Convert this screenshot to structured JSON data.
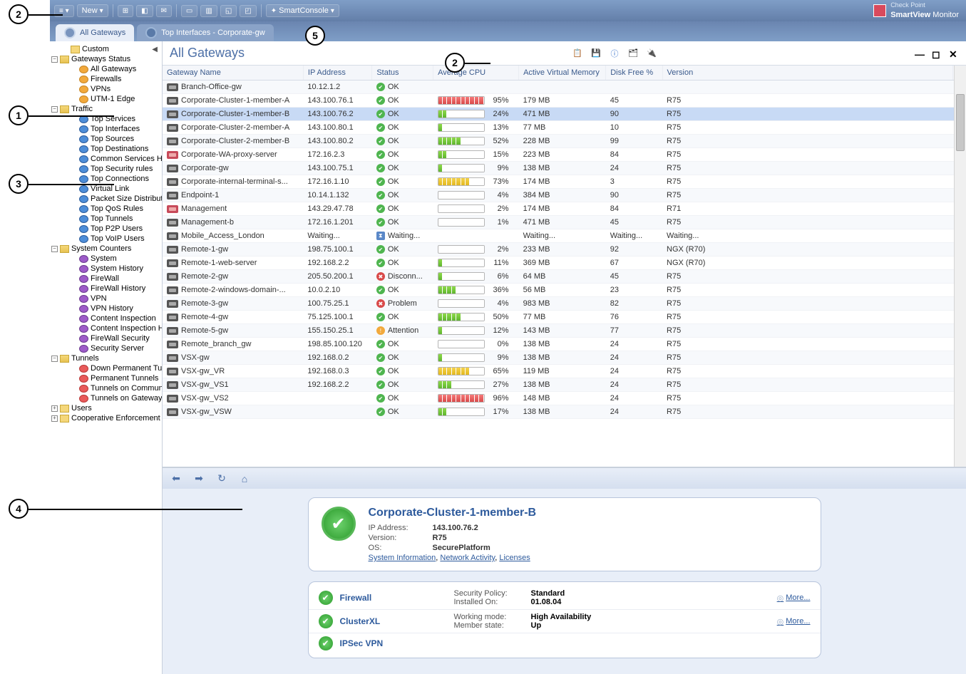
{
  "brand": {
    "line1": "Check Point",
    "line2a": "SmartView",
    "line2b": " Monitor"
  },
  "toolbar": {
    "smartconsole": "SmartConsole",
    "new": "New"
  },
  "tabs": [
    {
      "label": "All Gateways",
      "active": true
    },
    {
      "label": "Top Interfaces - Corporate-gw",
      "active": false
    }
  ],
  "sidebar": {
    "custom": "Custom",
    "gateways_status": "Gateways Status",
    "gw_items": [
      "All Gateways",
      "Firewalls",
      "VPNs",
      "UTM-1 Edge"
    ],
    "traffic": "Traffic",
    "traffic_items": [
      "Top Services",
      "Top Interfaces",
      "Top Sources",
      "Top Destinations",
      "Common Services History",
      "Top Security rules",
      "Top Connections",
      "Virtual Link",
      "Packet Size Distribution",
      "Top QoS Rules",
      "Top Tunnels",
      "Top P2P Users",
      "Top VoIP Users"
    ],
    "system_counters": "System Counters",
    "sys_items": [
      "System",
      "System History",
      "FireWall",
      "FireWall History",
      "VPN",
      "VPN History",
      "Content Inspection",
      "Content Inspection Histo",
      "FireWall Security",
      "Security Server"
    ],
    "tunnels": "Tunnels",
    "tun_items": [
      "Down Permanent Tunnels",
      "Permanent Tunnels",
      "Tunnels on Community",
      "Tunnels on Gateway"
    ],
    "users": "Users",
    "coop": "Cooperative Enforcement"
  },
  "content": {
    "title": "All Gateways",
    "columns": [
      "Gateway Name",
      "IP Address",
      "Status",
      "Average CPU",
      "Active Virtual Memory",
      "Disk Free %",
      "Version"
    ]
  },
  "rows": [
    {
      "name": "Branch-Office-gw",
      "ip": "10.12.1.2",
      "status": "OK",
      "st": "ok",
      "cpu": null,
      "mem": "",
      "disk": "",
      "ver": ""
    },
    {
      "name": "Corporate-Cluster-1-member-A",
      "ip": "143.100.76.1",
      "status": "OK",
      "st": "ok",
      "cpu": 95,
      "mem": "179 MB",
      "disk": "45",
      "ver": "R75"
    },
    {
      "name": "Corporate-Cluster-1-member-B",
      "ip": "143.100.76.2",
      "status": "OK",
      "st": "ok",
      "cpu": 24,
      "mem": "471 MB",
      "disk": "90",
      "ver": "R75",
      "selected": true
    },
    {
      "name": "Corporate-Cluster-2-member-A",
      "ip": "143.100.80.1",
      "status": "OK",
      "st": "ok",
      "cpu": 13,
      "mem": "77 MB",
      "disk": "10",
      "ver": "R75"
    },
    {
      "name": "Corporate-Cluster-2-member-B",
      "ip": "143.100.80.2",
      "status": "OK",
      "st": "ok",
      "cpu": 52,
      "mem": "228 MB",
      "disk": "99",
      "ver": "R75"
    },
    {
      "name": "Corporate-WA-proxy-server",
      "ip": "172.16.2.3",
      "status": "OK",
      "st": "ok",
      "cpu": 15,
      "mem": "223 MB",
      "disk": "84",
      "ver": "R75",
      "mgmt": true
    },
    {
      "name": "Corporate-gw",
      "ip": "143.100.75.1",
      "status": "OK",
      "st": "ok",
      "cpu": 9,
      "mem": "138 MB",
      "disk": "24",
      "ver": "R75"
    },
    {
      "name": "Corporate-internal-terminal-s...",
      "ip": "172.16.1.10",
      "status": "OK",
      "st": "ok",
      "cpu": 73,
      "mem": "174 MB",
      "disk": "3",
      "ver": "R75"
    },
    {
      "name": "Endpoint-1",
      "ip": "10.14.1.132",
      "status": "OK",
      "st": "ok",
      "cpu": 4,
      "mem": "384 MB",
      "disk": "90",
      "ver": "R75"
    },
    {
      "name": "Management",
      "ip": "143.29.47.78",
      "status": "OK",
      "st": "ok",
      "cpu": 2,
      "mem": "174 MB",
      "disk": "84",
      "ver": "R71",
      "mgmt": true
    },
    {
      "name": "Management-b",
      "ip": "172.16.1.201",
      "status": "OK",
      "st": "ok",
      "cpu": 1,
      "mem": "471 MB",
      "disk": "45",
      "ver": "R75"
    },
    {
      "name": "Mobile_Access_London",
      "ip": "Waiting...",
      "status": "Waiting...",
      "st": "wait",
      "cpu": null,
      "mem": "Waiting...",
      "disk": "Waiting...",
      "ver": "Waiting..."
    },
    {
      "name": "Remote-1-gw",
      "ip": "198.75.100.1",
      "status": "OK",
      "st": "ok",
      "cpu": 2,
      "mem": "233 MB",
      "disk": "92",
      "ver": "NGX (R70)"
    },
    {
      "name": "Remote-1-web-server",
      "ip": "192.168.2.2",
      "status": "OK",
      "st": "ok",
      "cpu": 11,
      "mem": "369 MB",
      "disk": "67",
      "ver": "NGX (R70)"
    },
    {
      "name": "Remote-2-gw",
      "ip": "205.50.200.1",
      "status": "Disconn...",
      "st": "disc",
      "cpu": 6,
      "mem": "64 MB",
      "disk": "45",
      "ver": "R75"
    },
    {
      "name": "Remote-2-windows-domain-...",
      "ip": "10.0.2.10",
      "status": "OK",
      "st": "ok",
      "cpu": 36,
      "mem": "56 MB",
      "disk": "23",
      "ver": "R75"
    },
    {
      "name": "Remote-3-gw",
      "ip": "100.75.25.1",
      "status": "Problem",
      "st": "prob",
      "cpu": 4,
      "mem": "983 MB",
      "disk": "82",
      "ver": "R75"
    },
    {
      "name": "Remote-4-gw",
      "ip": "75.125.100.1",
      "status": "OK",
      "st": "ok",
      "cpu": 50,
      "mem": "77 MB",
      "disk": "76",
      "ver": "R75"
    },
    {
      "name": "Remote-5-gw",
      "ip": "155.150.25.1",
      "status": "Attention",
      "st": "att",
      "cpu": 12,
      "mem": "143 MB",
      "disk": "77",
      "ver": "R75"
    },
    {
      "name": "Remote_branch_gw",
      "ip": "198.85.100.120",
      "status": "OK",
      "st": "ok",
      "cpu": 0,
      "mem": "138 MB",
      "disk": "24",
      "ver": "R75"
    },
    {
      "name": "VSX-gw",
      "ip": "192.168.0.2",
      "status": "OK",
      "st": "ok",
      "cpu": 9,
      "mem": "138 MB",
      "disk": "24",
      "ver": "R75"
    },
    {
      "name": "VSX-gw_VR",
      "ip": "192.168.0.3",
      "status": "OK",
      "st": "ok",
      "cpu": 65,
      "mem": "119 MB",
      "disk": "24",
      "ver": "R75"
    },
    {
      "name": "VSX-gw_VS1",
      "ip": "192.168.2.2",
      "status": "OK",
      "st": "ok",
      "cpu": 27,
      "mem": "138 MB",
      "disk": "24",
      "ver": "R75"
    },
    {
      "name": "VSX-gw_VS2",
      "ip": "",
      "status": "OK",
      "st": "ok",
      "cpu": 96,
      "mem": "148 MB",
      "disk": "24",
      "ver": "R75"
    },
    {
      "name": "VSX-gw_VSW",
      "ip": "",
      "status": "OK",
      "st": "ok",
      "cpu": 17,
      "mem": "138 MB",
      "disk": "24",
      "ver": "R75"
    }
  ],
  "detail": {
    "title": "Corporate-Cluster-1-member-B",
    "ip_label": "IP Address:",
    "ip": "143.100.76.2",
    "ver_label": "Version:",
    "ver": "R75",
    "os_label": "OS:",
    "os": "SecurePlatform",
    "links": [
      "System Information",
      "Network Activity",
      "Licenses"
    ]
  },
  "services": [
    {
      "name": "Firewall",
      "props": [
        {
          "l": "Security Policy:",
          "v": "Standard"
        },
        {
          "l": "Installed On:",
          "v": "01.08.04"
        }
      ],
      "more": "More..."
    },
    {
      "name": "ClusterXL",
      "props": [
        {
          "l": "Working mode:",
          "v": "High Availability"
        },
        {
          "l": "Member state:",
          "v": "Up"
        }
      ],
      "more": "More..."
    },
    {
      "name": "IPSec VPN",
      "props": [],
      "more": ""
    }
  ],
  "callouts": {
    "c1": "1",
    "c2": "2",
    "c2b": "2",
    "c3": "3",
    "c4": "4",
    "c5": "5"
  }
}
